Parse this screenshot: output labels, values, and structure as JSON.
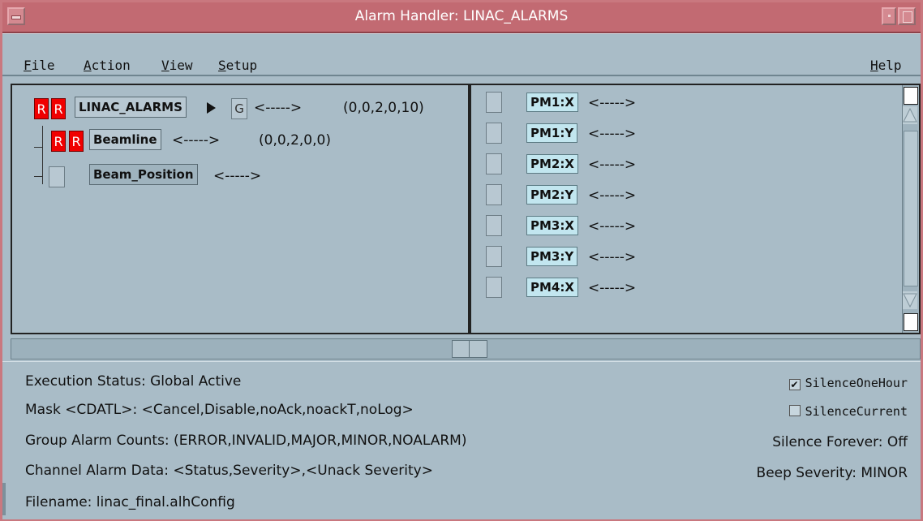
{
  "window": {
    "title": "Alarm Handler: LINAC_ALARMS"
  },
  "menubar": {
    "file": "File",
    "action": "Action",
    "view": "View",
    "setup": "Setup",
    "help": "Help"
  },
  "tree": {
    "root": {
      "sev1": "R",
      "sev2": "R",
      "name": "LINAC_ALARMS",
      "guidance": "G",
      "arrow": "<----->",
      "counts": "(0,0,2,0,10)"
    },
    "beamline": {
      "sev1": "R",
      "sev2": "R",
      "name": "Beamline",
      "arrow": "<----->",
      "counts": "(0,0,2,0,0)"
    },
    "beam_position": {
      "name": "Beam_Position",
      "arrow": "<----->"
    }
  },
  "channels": [
    {
      "name": "PM1:X",
      "arrow": "<----->"
    },
    {
      "name": "PM1:Y",
      "arrow": "<----->"
    },
    {
      "name": "PM2:X",
      "arrow": "<----->"
    },
    {
      "name": "PM2:Y",
      "arrow": "<----->"
    },
    {
      "name": "PM3:X",
      "arrow": "<----->"
    },
    {
      "name": "PM3:Y",
      "arrow": "<----->"
    },
    {
      "name": "PM4:X",
      "arrow": "<----->"
    }
  ],
  "status": {
    "execution": "Execution Status:  Global Active",
    "mask": "Mask <CDATL>:  <Cancel,Disable,noAck,noackT,noLog>",
    "group_counts": "Group Alarm Counts:  (ERROR,INVALID,MAJOR,MINOR,NOALARM)",
    "channel_data": "Channel Alarm Data:  <Status,Severity>,<Unack Severity>",
    "filename": "Filename:   linac_final.alhConfig",
    "silence_one_hour": "SilenceOneHour",
    "silence_current": "SilenceCurrent",
    "silence_forever": "Silence Forever:  Off",
    "beep_severity": "Beep Severity:  MINOR"
  },
  "colors": {
    "titlebar": "#c26a72",
    "alarm_major": "#f00000",
    "channel_button": "#c2e6ef",
    "background": "#a9bcc7"
  }
}
